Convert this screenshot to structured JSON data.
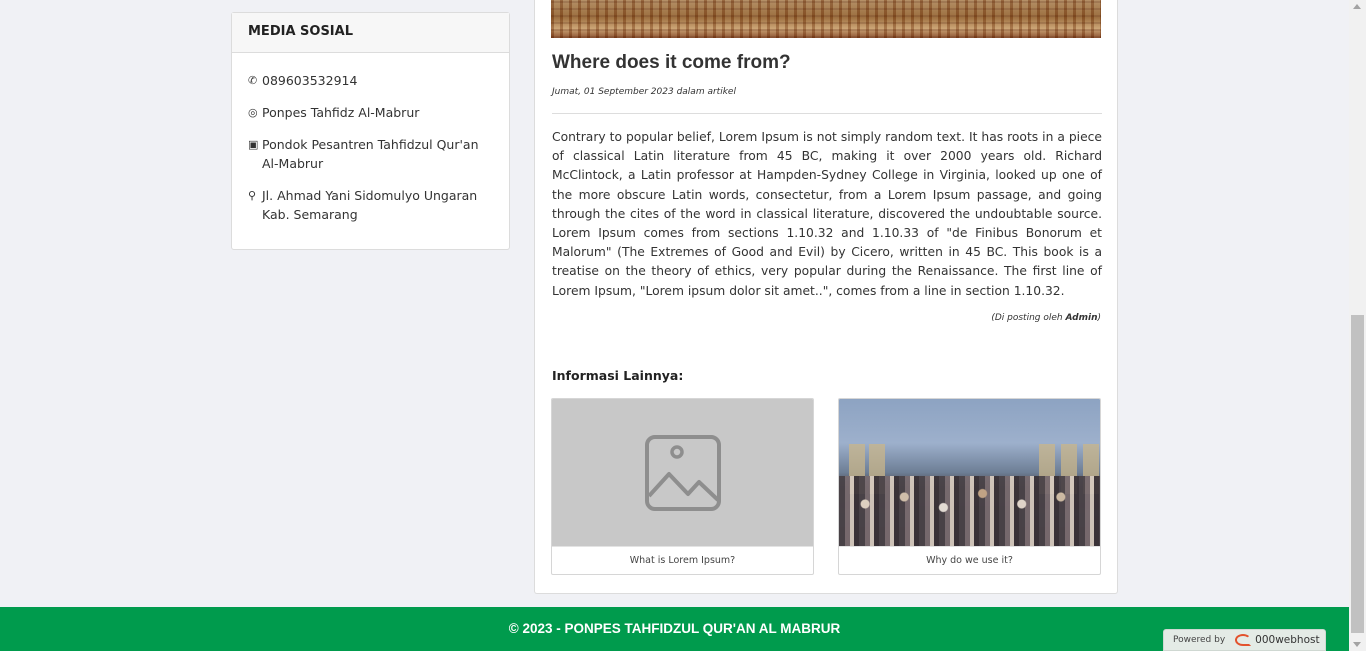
{
  "sidebar": {
    "heading": "MEDIA SOSIAL",
    "items": [
      {
        "icon": "whatsapp-icon",
        "glyph": "✆",
        "label": "089603532914"
      },
      {
        "icon": "instagram-icon",
        "glyph": "◎",
        "label": "Ponpes Tahfidz Al-Mabrur"
      },
      {
        "icon": "facebook-icon",
        "glyph": "▣",
        "label": "Pondok Pesantren Tahfidzul Qur'an Al-Mabrur"
      },
      {
        "icon": "map-marker-icon",
        "glyph": "⚲",
        "label": "Jl. Ahmad Yani Sidomulyo Ungaran Kab. Semarang"
      }
    ]
  },
  "article": {
    "title": "Where does it come from?",
    "meta": "Jumat, 01 September 2023 dalam artikel",
    "body": "Contrary to popular belief, Lorem Ipsum is not simply random text. It has roots in a piece of classical Latin literature from 45 BC, making it over 2000 years old. Richard McClintock, a Latin professor at Hampden-Sydney College in Virginia, looked up one of the more obscure Latin words, consectetur, from a Lorem Ipsum passage, and going through the cites of the word in classical literature, discovered the undoubtable source. Lorem Ipsum comes from sections 1.10.32 and 1.10.33 of \"de Finibus Bonorum et Malorum\" (The Extremes of Good and Evil) by Cicero, written in 45 BC. This book is a treatise on the theory of ethics, very popular during the Renaissance. The first line of Lorem Ipsum, \"Lorem ipsum dolor sit amet..\", comes from a line in section 1.10.32.",
    "posted_prefix": "(Di posting oleh ",
    "author": "Admin",
    "posted_suffix": ")"
  },
  "related": {
    "heading": "Informasi Lainnya:",
    "items": [
      {
        "caption": "What is Lorem Ipsum?"
      },
      {
        "caption": "Why do we use it?"
      }
    ]
  },
  "footer": {
    "text": "© 2023 - PONPES TAHFIDZUL QUR'AN AL MABRUR",
    "badge_prefix": "Powered by",
    "badge_brand": "000webhost"
  },
  "colors": {
    "footer_bg": "#009b4d",
    "page_bg": "#f0f1f5"
  }
}
